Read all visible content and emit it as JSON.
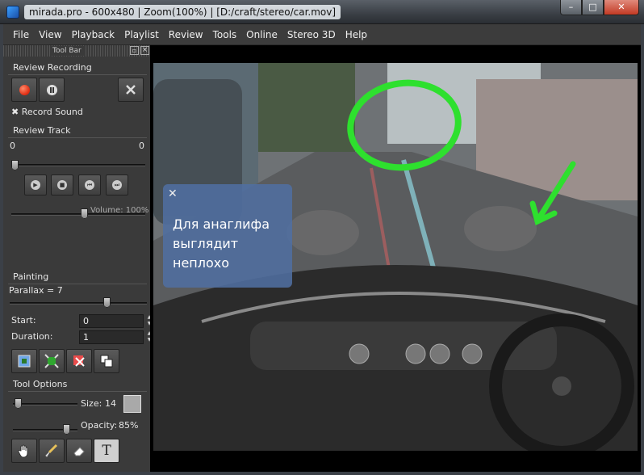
{
  "window": {
    "title": "mirada.pro - 600x480 | Zoom(100%) | [D:/craft/stereo/car.mov]",
    "controls": {
      "minimize": "–",
      "maximize": "□",
      "close": "✕"
    }
  },
  "menu": [
    "File",
    "View",
    "Playback",
    "Playlist",
    "Review",
    "Tools",
    "Online",
    "Stereo 3D",
    "Help"
  ],
  "toolbar": {
    "header": "Tool Bar",
    "review_recording": {
      "title": "Review Recording",
      "record_sound_label": "Record Sound",
      "record_sound_checked": true
    },
    "review_track": {
      "title": "Review Track",
      "start": "0",
      "end": "0",
      "volume_label": "Volume: 100%",
      "volume": 1.0
    },
    "painting": {
      "title": "Painting",
      "parallax_label": "Parallax = 7",
      "start_label": "Start:",
      "start_value": "0",
      "duration_label": "Duration:",
      "duration_value": "1"
    },
    "tool_options": {
      "title": "Tool Options",
      "size_label": "Size:",
      "size_value": "14",
      "opacity_label": "Opacity:",
      "opacity_value": "85%",
      "swatch_color": "#a9a9a9",
      "text_tool_label": "T"
    }
  },
  "overlay": {
    "close_glyph": "✕",
    "note_text": "Для анаглифа выглядит неплохо",
    "annotation_color": "#2ee02e"
  },
  "icons": [
    "record-icon",
    "pause-icon",
    "clear-recording-icon",
    "play-icon",
    "stop-icon",
    "prev-icon",
    "next-icon",
    "frame-icon",
    "fit-icon",
    "delete-icon",
    "copy-icon",
    "hand-icon",
    "brush-icon",
    "eraser-icon",
    "text-icon"
  ]
}
